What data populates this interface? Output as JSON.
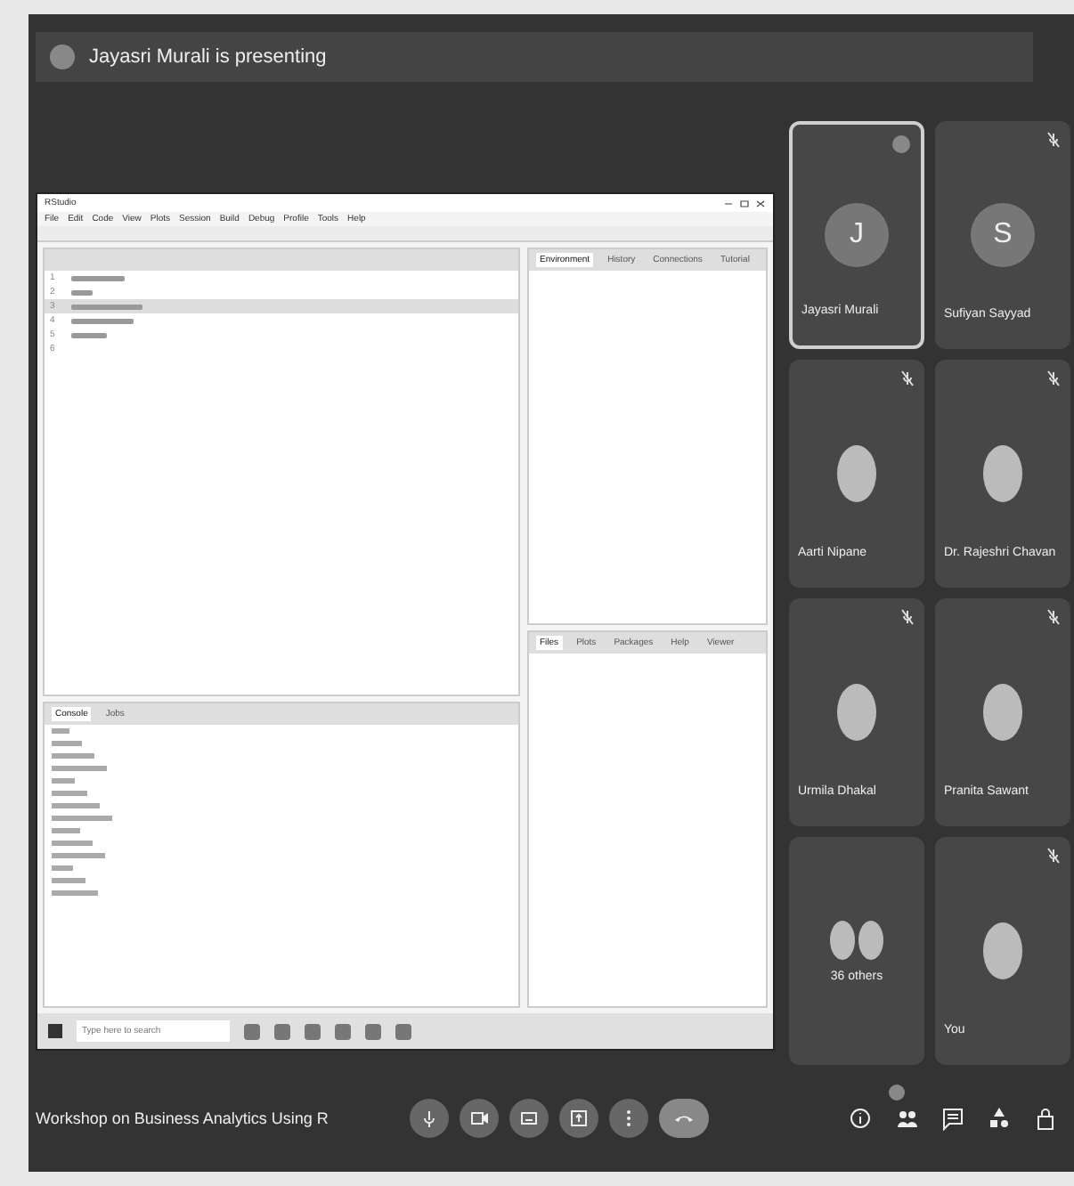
{
  "banner": {
    "text": "Jayasri Murali is presenting"
  },
  "shared_screen": {
    "title": "RStudio",
    "menu": [
      "File",
      "Edit",
      "Code",
      "View",
      "Plots",
      "Session",
      "Build",
      "Debug",
      "Profile",
      "Tools",
      "Help"
    ],
    "editor": {
      "lines": [
        {
          "number": "1",
          "selected": false
        },
        {
          "number": "2",
          "selected": false
        },
        {
          "number": "3",
          "selected": true
        },
        {
          "number": "4",
          "selected": false
        },
        {
          "number": "5",
          "selected": false
        },
        {
          "number": "6",
          "selected": false
        }
      ]
    },
    "env_tabs": [
      {
        "label": "Environment",
        "selected": true
      },
      {
        "label": "History",
        "selected": false
      },
      {
        "label": "Connections",
        "selected": false
      },
      {
        "label": "Tutorial",
        "selected": false
      }
    ],
    "files_tabs": [
      {
        "label": "Files",
        "selected": true
      },
      {
        "label": "Plots",
        "selected": false
      },
      {
        "label": "Packages",
        "selected": false
      },
      {
        "label": "Help",
        "selected": false
      },
      {
        "label": "Viewer",
        "selected": false
      }
    ],
    "console_tabs": [
      {
        "label": "Console",
        "selected": true
      },
      {
        "label": "Jobs",
        "selected": false
      }
    ],
    "taskbar": {
      "search_placeholder": "Type here to search"
    }
  },
  "participants": [
    {
      "name": "Jayasri Murali",
      "kind": "initial",
      "initial": "J",
      "speaking": true,
      "muted": false
    },
    {
      "name": "Sufiyan Sayyad",
      "kind": "initial",
      "initial": "S",
      "speaking": false,
      "muted": true
    },
    {
      "name": "Aarti Nipane",
      "kind": "photo",
      "speaking": false,
      "muted": true
    },
    {
      "name": "Dr. Rajeshri Chavan",
      "kind": "photo",
      "speaking": false,
      "muted": true
    },
    {
      "name": "Urmila Dhakal",
      "kind": "photo",
      "speaking": false,
      "muted": true
    },
    {
      "name": "Pranita Sawant",
      "kind": "photo",
      "speaking": false,
      "muted": true
    },
    {
      "name": "36 others",
      "kind": "group",
      "speaking": false,
      "muted": false
    },
    {
      "name": "You",
      "kind": "photo",
      "speaking": false,
      "muted": true
    }
  ],
  "footer": {
    "meeting_title": "Workshop on Business Analytics Using R",
    "controls": [
      {
        "kind": "mic"
      },
      {
        "kind": "camera"
      },
      {
        "kind": "captions"
      },
      {
        "kind": "present"
      },
      {
        "kind": "more"
      },
      {
        "kind": "leave"
      }
    ],
    "side_icons": [
      {
        "kind": "info"
      },
      {
        "kind": "people"
      },
      {
        "kind": "chat"
      },
      {
        "kind": "activities"
      },
      {
        "kind": "lock"
      }
    ]
  }
}
